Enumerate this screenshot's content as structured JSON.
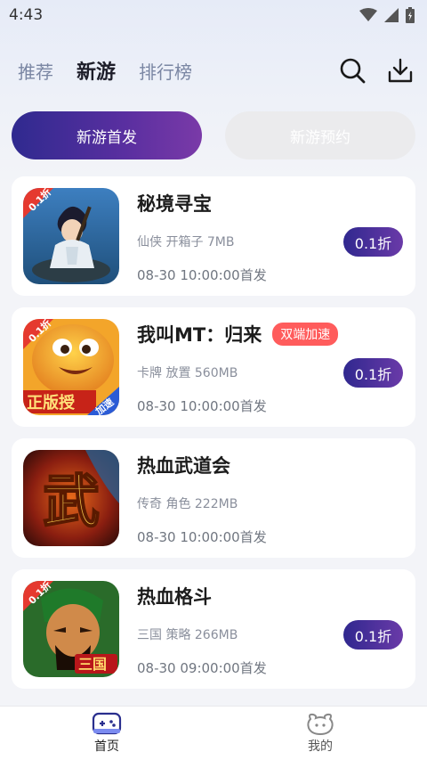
{
  "status_bar": {
    "time": "4:43"
  },
  "header": {
    "tabs": [
      {
        "label": "推荐",
        "active": false
      },
      {
        "label": "新游",
        "active": true
      },
      {
        "label": "排行榜",
        "active": false
      }
    ],
    "actions": {
      "search": "search-icon",
      "download": "download-icon"
    }
  },
  "segments": [
    {
      "label": "新游首发",
      "active": true
    },
    {
      "label": "新游预约",
      "active": false
    }
  ],
  "games": [
    {
      "name": "秘境寻宝",
      "tags": "仙侠 开箱子 7MB",
      "date": "08-30 10:00:00首发",
      "discount": "0.1折",
      "badge": ""
    },
    {
      "name": "我叫MT：归来",
      "tags": "卡牌 放置 560MB",
      "date": "08-30 10:00:00首发",
      "discount": "0.1折",
      "badge": "双端加速"
    },
    {
      "name": "热血武道会",
      "tags": "传奇 角色 222MB",
      "date": "08-30 10:00:00首发",
      "discount": "",
      "badge": ""
    },
    {
      "name": "热血格斗",
      "tags": "三国 策略 266MB",
      "date": "08-30 09:00:00首发",
      "discount": "0.1折",
      "badge": ""
    }
  ],
  "thumb_overlays": {
    "g1_corner": "0.1折",
    "g2_corner": "0.1折",
    "g2_banner": "正版授",
    "g2_speed": "加速",
    "g3_glyph": "武",
    "g4_corner": "0.1折",
    "g4_banner": "三国"
  },
  "bottom_nav": [
    {
      "label": "首页",
      "icon": "gamepad-icon",
      "active": true
    },
    {
      "label": "我的",
      "icon": "profile-icon",
      "active": false
    }
  ],
  "colors": {
    "accent_start": "#2f2a8f",
    "accent_end": "#7a3aa8",
    "badge": "#ff5c5c",
    "inactive_tab": "#7a86a3"
  }
}
